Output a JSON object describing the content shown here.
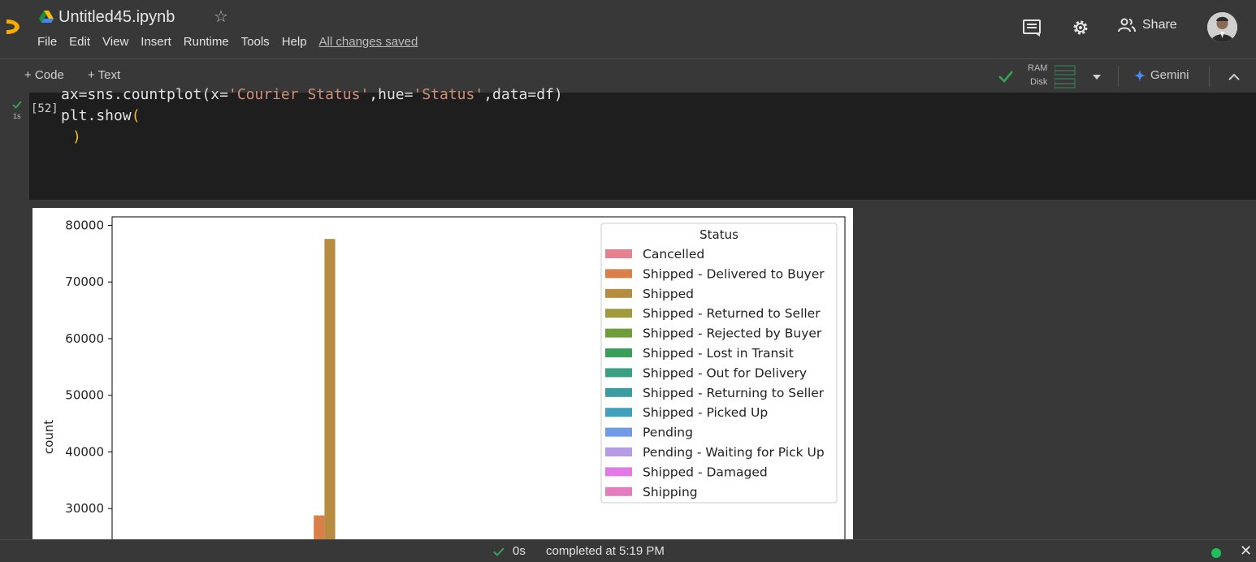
{
  "header": {
    "title": "Untitled45.ipynb",
    "menu": [
      "File",
      "Edit",
      "View",
      "Insert",
      "Runtime",
      "Tools",
      "Help"
    ],
    "saved_status": "All changes saved",
    "share_label": "Share"
  },
  "toolbar": {
    "code_label": "+ Code",
    "text_label": "+ Text",
    "ram_label": "RAM",
    "disk_label": "Disk",
    "gemini_label": "Gemini"
  },
  "cell": {
    "exec_count": "[52]",
    "exec_time": "1s",
    "line1_pre": "ax=sns.countplot(x=",
    "line1_str1": "'Courier Status'",
    "line1_mid": ",hue=",
    "line1_str2": "'Status'",
    "line1_post": ",data=df)",
    "line2": "plt.show(",
    "line3": ")"
  },
  "chart_data": {
    "type": "bar",
    "ylabel": "count",
    "yticks": [
      30000,
      40000,
      50000,
      60000,
      70000,
      80000
    ],
    "ylim": [
      20000,
      81500
    ],
    "legend_title": "Status",
    "legend_placement": "top-right",
    "series": [
      {
        "name": "Cancelled",
        "color": "#e8818f"
      },
      {
        "name": "Shipped - Delivered to Buyer",
        "color": "#d9804a",
        "value": 28800
      },
      {
        "name": "Shipped",
        "color": "#b68d40",
        "value": 77600
      },
      {
        "name": "Shipped - Returned to Seller",
        "color": "#9f9a3d"
      },
      {
        "name": "Shipped - Rejected by Buyer",
        "color": "#6f9f3a"
      },
      {
        "name": "Shipped - Lost in Transit",
        "color": "#3a9e5b"
      },
      {
        "name": "Shipped - Out for Delivery",
        "color": "#3aa084"
      },
      {
        "name": "Shipped - Returning to Seller",
        "color": "#3c9da0"
      },
      {
        "name": "Shipped - Picked Up",
        "color": "#41a0bb"
      },
      {
        "name": "Pending",
        "color": "#6f9be8"
      },
      {
        "name": "Pending - Waiting for Pick Up",
        "color": "#b59ae8"
      },
      {
        "name": "Shipped - Damaged",
        "color": "#e179e6"
      },
      {
        "name": "Shipping",
        "color": "#e57cbf"
      }
    ]
  },
  "statusbar": {
    "time": "0s",
    "completed": "completed at 5:19 PM"
  }
}
